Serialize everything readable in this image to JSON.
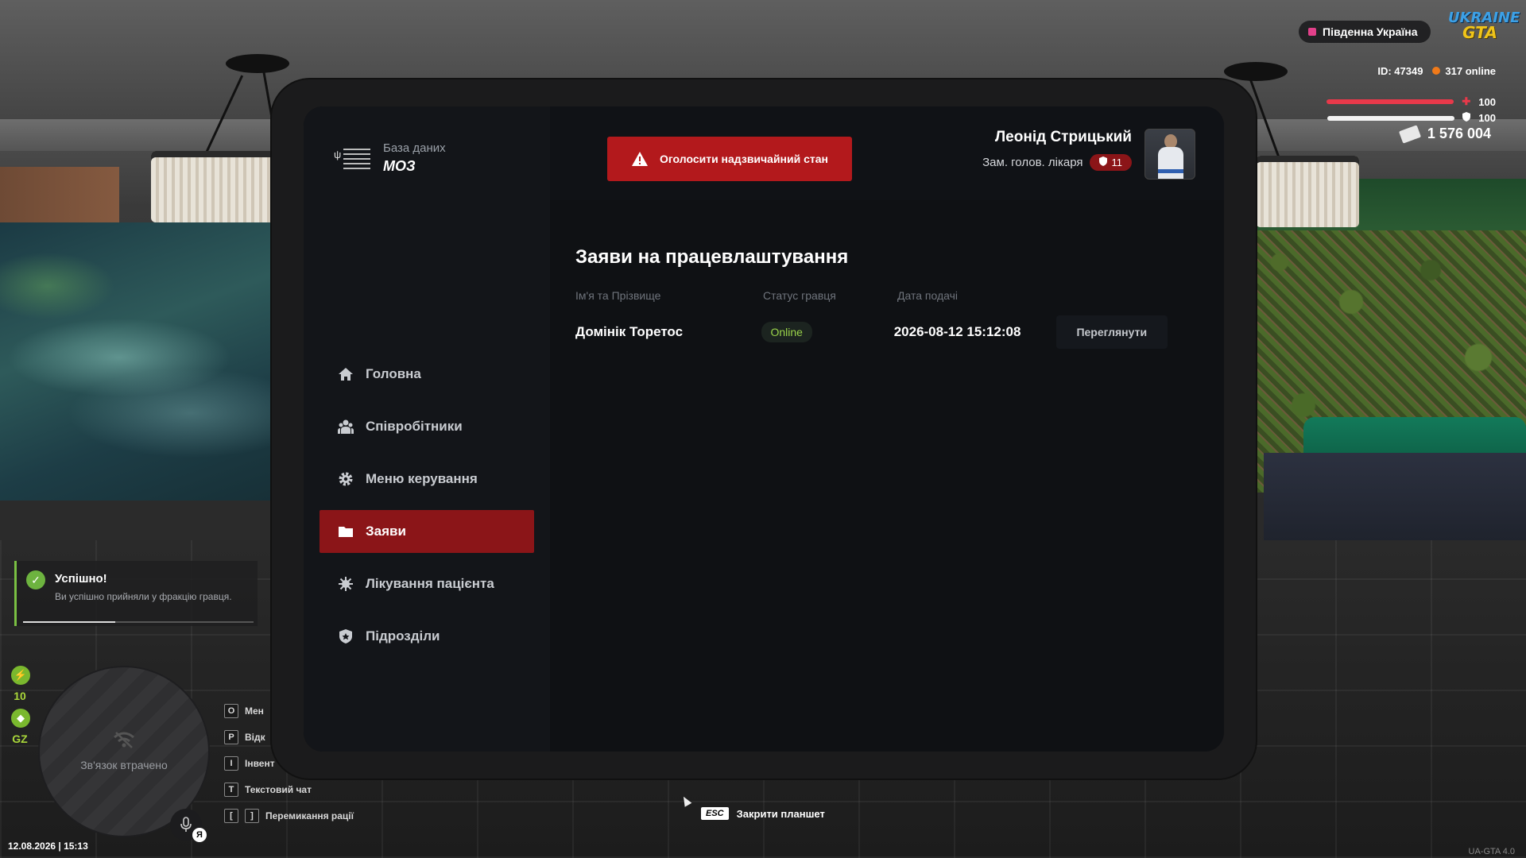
{
  "tablet": {
    "logo": {
      "subtitle": "База даних",
      "title": "МОЗ"
    },
    "emergency_button": "Оголосити надзвичайний стан",
    "user": {
      "name": "Леонід Стрицький",
      "role": "Зам. голов. лікаря",
      "rank": "11"
    },
    "nav": [
      {
        "label": "Головна",
        "icon": "home-icon"
      },
      {
        "label": "Співробітники",
        "icon": "people-icon"
      },
      {
        "label": "Меню керування",
        "icon": "gear-icon"
      },
      {
        "label": "Заяви",
        "icon": "folder-icon",
        "active": true
      },
      {
        "label": "Лікування пацієнта",
        "icon": "virus-icon"
      },
      {
        "label": "Підрозділи",
        "icon": "shield-icon"
      }
    ],
    "page_title": "Заяви на працевлаштування",
    "table": {
      "columns": [
        "Ім'я та Прізвище",
        "Статус гравця",
        "Дата подачі"
      ],
      "rows": [
        {
          "name": "Домінік Торетос",
          "status": "Online",
          "date": "2026-08-12 15:12:08",
          "action": "Переглянути"
        }
      ]
    }
  },
  "hud": {
    "server": "Південна Україна",
    "logo_line1": "UKRAINE",
    "logo_line2": "GTA",
    "player_id": "ID: 47349",
    "online": "317 online",
    "health": "100",
    "armor": "100",
    "health_fraction": 1.0,
    "armor_fraction": 1.0,
    "money": "1 576 004",
    "notification": {
      "title": "Успішно!",
      "message": "Ви успішно прийняли у фракцію гравця.",
      "progress": 0.4
    },
    "side_stats": {
      "energy": "10",
      "zone": "GZ"
    },
    "radar_text": "Зв'язок втрачено",
    "mic_badge": "Я",
    "keybinds": [
      {
        "keys": [
          "O"
        ],
        "label": "Мен"
      },
      {
        "keys": [
          "P"
        ],
        "label": "Відк"
      },
      {
        "keys": [
          "I"
        ],
        "label": "Інвент"
      },
      {
        "keys": [
          "T"
        ],
        "label": "Текстовий чат"
      },
      {
        "keys": [
          "[",
          "]"
        ],
        "label": "Перемикання рації"
      }
    ],
    "datetime": "12.08.2026 | 15:13",
    "esc_key": "ESC",
    "esc_label": "Закрити планшет",
    "version": "UA-GTA 4.0",
    "colors": {
      "accent": "#b3191c",
      "active_nav": "#8b1518",
      "online": "#9ad34a",
      "health": "#e8394a"
    }
  }
}
